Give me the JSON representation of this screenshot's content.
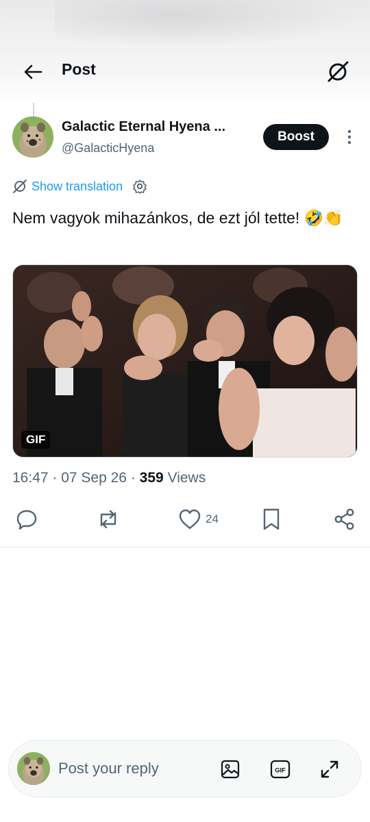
{
  "header": {
    "title": "Post",
    "back_icon": "back-arrow-icon",
    "right_icon": "grok-icon"
  },
  "post": {
    "display_name": "Galactic Eternal Hyena ...",
    "handle": "@GalacticHyena",
    "boost_label": "Boost",
    "translate_label": "Show translation",
    "text": "Nem vagyok mihazánkos, de ezt jól tette! 🤣👏",
    "media_badge": "GIF",
    "time": "16:47",
    "date": "07 Sep 26",
    "views_count": "359",
    "views_label": "Views"
  },
  "actions": {
    "like_count": "24"
  },
  "reply": {
    "placeholder": "Post your reply"
  },
  "colors": {
    "accent": "#1d9bf0",
    "text": "#0f1419",
    "muted": "#536471",
    "boost_bg": "#0f1419"
  }
}
